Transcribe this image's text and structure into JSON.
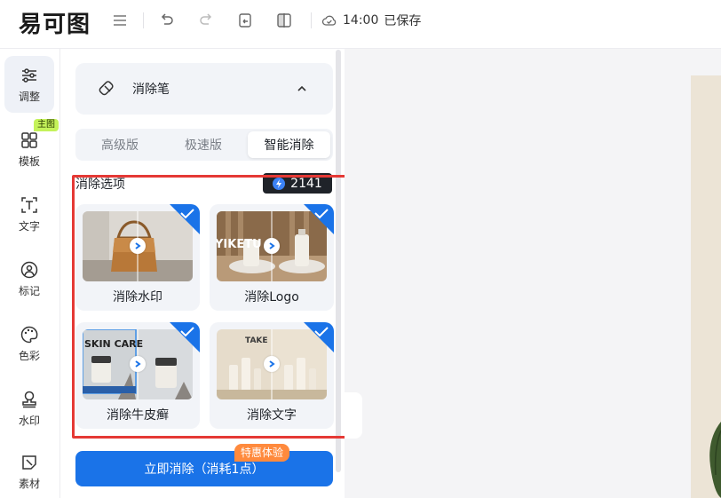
{
  "app": {
    "logo": "易可图",
    "save_time": "14:00",
    "save_label": "已保存"
  },
  "rail": {
    "items": [
      {
        "label": "调整",
        "icon": "sliders-icon",
        "active": true
      },
      {
        "label": "模板",
        "icon": "grid-icon"
      },
      {
        "label": "文字",
        "icon": "text-icon"
      },
      {
        "label": "标记",
        "icon": "marker-icon"
      },
      {
        "label": "色彩",
        "icon": "palette-icon"
      },
      {
        "label": "水印",
        "icon": "stamp-icon"
      },
      {
        "label": "素材",
        "icon": "material-icon"
      }
    ],
    "template_badge": "主图"
  },
  "panel": {
    "tool_name": "消除笔",
    "tabs": [
      {
        "label": "高级版",
        "active": false
      },
      {
        "label": "极速版",
        "active": false
      },
      {
        "label": "智能消除",
        "active": true
      }
    ],
    "options_title": "消除选项",
    "credits": "2141",
    "options": [
      {
        "label": "消除水印",
        "checked": true,
        "thumb_text": ""
      },
      {
        "label": "消除Logo",
        "checked": true,
        "thumb_text": "YIKETU"
      },
      {
        "label": "消除牛皮癣",
        "checked": true,
        "thumb_text": "SKIN CARE"
      },
      {
        "label": "消除文字",
        "checked": true,
        "thumb_text": "TAKE"
      }
    ],
    "action_button": "立即消除（消耗1点）",
    "promo_badge": "特惠体验"
  },
  "colors": {
    "accent": "#1a73e8",
    "highlight": "#e53935",
    "promo": "#ff8a3d",
    "badge": "#c4f25a"
  }
}
